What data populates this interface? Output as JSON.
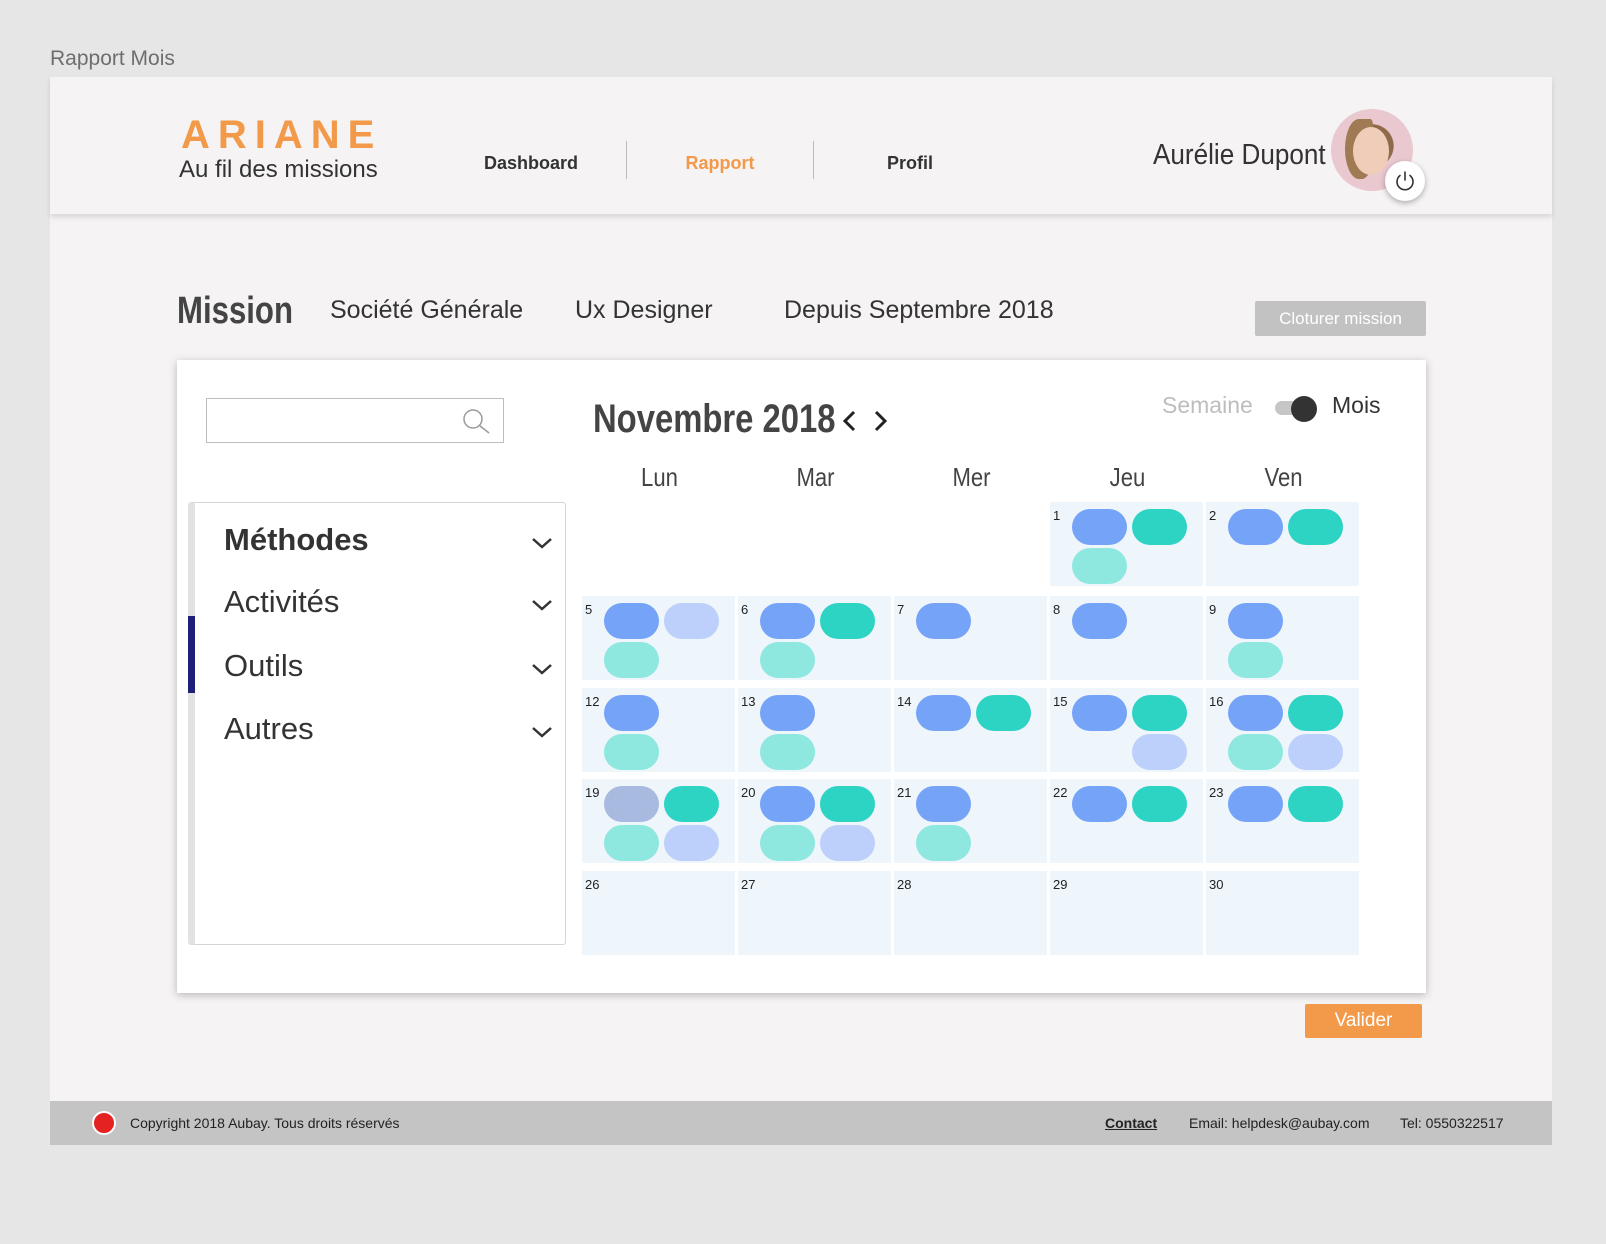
{
  "frame_title": "Rapport Mois",
  "header": {
    "logo_title": "ARIANE",
    "logo_subtitle": "Au fil des missions",
    "nav": [
      {
        "label": "Dashboard",
        "active": false
      },
      {
        "label": "Rapport",
        "active": true
      },
      {
        "label": "Profil",
        "active": false
      }
    ],
    "user_name": "Aurélie Dupont"
  },
  "mission": {
    "label": "Mission",
    "company": "Société Générale",
    "role": "Ux Designer",
    "since": "Depuis Septembre 2018",
    "close_button": "Cloturer mission"
  },
  "filters": {
    "search_placeholder": "",
    "items": [
      {
        "label": "Méthodes"
      },
      {
        "label": "Activités"
      },
      {
        "label": "Outils"
      },
      {
        "label": "Autres"
      }
    ]
  },
  "calendar": {
    "month_title": "Novembre 2018",
    "view_week": "Semaine",
    "view_month": "Mois",
    "days": [
      "Lun",
      "Mar",
      "Mer",
      "Jeu",
      "Ven"
    ],
    "cells": [
      {
        "num": "1",
        "pills": [
          "blue",
          "teal",
          "mint"
        ]
      },
      {
        "num": "2",
        "pills": [
          "blue",
          "teal"
        ]
      },
      {
        "num": "5",
        "pills": [
          "blue",
          "light",
          "mint"
        ]
      },
      {
        "num": "6",
        "pills": [
          "blue",
          "teal",
          "mint"
        ]
      },
      {
        "num": "7",
        "pills": [
          "blue"
        ]
      },
      {
        "num": "8",
        "pills": [
          "blue"
        ]
      },
      {
        "num": "9",
        "pills": [
          "blue",
          null,
          "mint"
        ]
      },
      {
        "num": "12",
        "pills": [
          "blue",
          null,
          "mint"
        ]
      },
      {
        "num": "13",
        "pills": [
          "blue",
          null,
          "mint"
        ]
      },
      {
        "num": "14",
        "pills": [
          "blue",
          "teal"
        ]
      },
      {
        "num": "15",
        "pills": [
          "blue",
          "teal",
          null,
          "light"
        ]
      },
      {
        "num": "16",
        "pills": [
          "blue",
          "teal",
          "mint",
          "light"
        ]
      },
      {
        "num": "19",
        "pills": [
          "grey",
          "teal",
          "mint",
          "light"
        ]
      },
      {
        "num": "20",
        "pills": [
          "blue",
          "teal",
          "mint",
          "light"
        ]
      },
      {
        "num": "21",
        "pills": [
          "blue",
          null,
          "mint"
        ]
      },
      {
        "num": "22",
        "pills": [
          "blue",
          "teal"
        ]
      },
      {
        "num": "23",
        "pills": [
          "blue",
          "teal"
        ]
      },
      {
        "num": "26",
        "pills": []
      },
      {
        "num": "27",
        "pills": []
      },
      {
        "num": "28",
        "pills": []
      },
      {
        "num": "29",
        "pills": []
      },
      {
        "num": "30",
        "pills": []
      }
    ]
  },
  "validate_button": "Valider",
  "footer": {
    "copyright": "Copyright 2018 Aubay. Tous droits réservés",
    "contact": "Contact",
    "email": "Email: helpdesk@aubay.com",
    "tel": "Tel: 0550322517"
  },
  "colors": {
    "accent": "#f29a4a",
    "blue": "#74a3f7",
    "teal": "#2dd4c3",
    "mint": "#8ee8df",
    "light": "#bcd0fb",
    "grey": "#a8badf",
    "indicator": "#1d1f7a"
  }
}
